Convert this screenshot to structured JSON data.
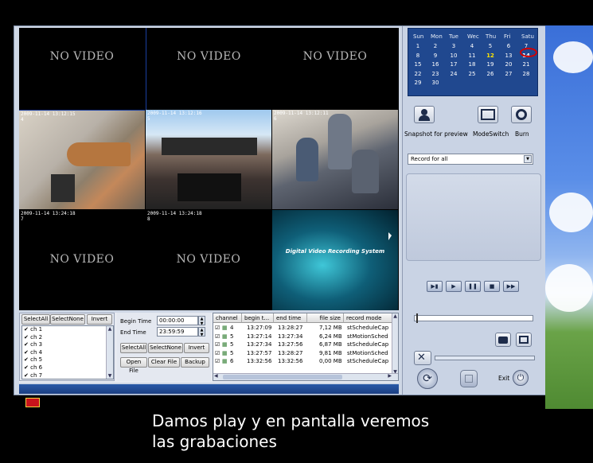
{
  "grid": {
    "no_video_label": "NO VIDEO",
    "cells": [
      {
        "type": "novideo"
      },
      {
        "type": "novideo"
      },
      {
        "type": "novideo"
      },
      {
        "type": "camera",
        "timestamp": "2009-11-14 13:12:15",
        "channel": "4"
      },
      {
        "type": "camera",
        "timestamp": "2009-11-14 13:12:16",
        "channel": "5"
      },
      {
        "type": "camera",
        "timestamp": "2009-11-14 13:12:11",
        "channel": "6"
      },
      {
        "type": "novideo",
        "timestamp": "2009-11-14 13:24:18",
        "channel": "7"
      },
      {
        "type": "novideo",
        "timestamp": "2009-11-14 13:24:18",
        "channel": "8"
      },
      {
        "type": "logo",
        "text": "Digital Video Recording System"
      }
    ]
  },
  "channels": {
    "select_all": "SelectAll",
    "select_none": "SelectNone",
    "invert": "Invert",
    "items": [
      "ch 1",
      "ch 2",
      "ch 3",
      "ch 4",
      "ch 5",
      "ch 6",
      "ch 7"
    ]
  },
  "time": {
    "begin_label": "Begin Time",
    "begin_value": "00:00:00",
    "end_label": "End Time",
    "end_value": "23:59:59",
    "select_all": "SelectAll",
    "select_none": "SelectNone",
    "invert": "Invert",
    "open_file": "Open File",
    "clear_file": "Clear File",
    "backup": "Backup"
  },
  "table": {
    "headers": [
      "channel",
      "begin t...",
      "end time",
      "file size",
      "record mode"
    ],
    "rows": [
      {
        "ch": "4",
        "begin": "13:27:09",
        "end": "13:28:27",
        "size": "7,12 MB",
        "mode": "stScheduleCap"
      },
      {
        "ch": "5",
        "begin": "13:27:14",
        "end": "13:27:34",
        "size": "6,24 MB",
        "mode": "stMotionSched"
      },
      {
        "ch": "5",
        "begin": "13:27:34",
        "end": "13:27:56",
        "size": "6,87 MB",
        "mode": "stScheduleCap"
      },
      {
        "ch": "5",
        "begin": "13:27:57",
        "end": "13:28:27",
        "size": "9,81 MB",
        "mode": "stMotionSched"
      },
      {
        "ch": "6",
        "begin": "13:32:56",
        "end": "13:32:56",
        "size": "0,00 MB",
        "mode": "stScheduleCap"
      }
    ]
  },
  "calendar": {
    "days": [
      "Sun",
      "Mon",
      "Tue",
      "Wec",
      "Thu",
      "Fri",
      "Satu"
    ],
    "weeks": [
      [
        "1",
        "2",
        "3",
        "4",
        "5",
        "6",
        "7"
      ],
      [
        "8",
        "9",
        "10",
        "11",
        "12",
        "13",
        "14"
      ],
      [
        "15",
        "16",
        "17",
        "18",
        "19",
        "20",
        "21"
      ],
      [
        "22",
        "23",
        "24",
        "25",
        "26",
        "27",
        "28"
      ],
      [
        "29",
        "30",
        "",
        "",
        "",
        "",
        ""
      ]
    ],
    "highlight_color": "#ffe600",
    "today_color": "#d40000"
  },
  "controls": {
    "snapshot_label": "Snapshot for preview",
    "modeswitch_label": "ModeSwitch",
    "burn_label": "Burn",
    "record_option": "Record for all",
    "exit_label": "Exit"
  },
  "subtitle": {
    "line1": "Damos play y en pantalla veremos",
    "line2": "las grabaciones"
  }
}
